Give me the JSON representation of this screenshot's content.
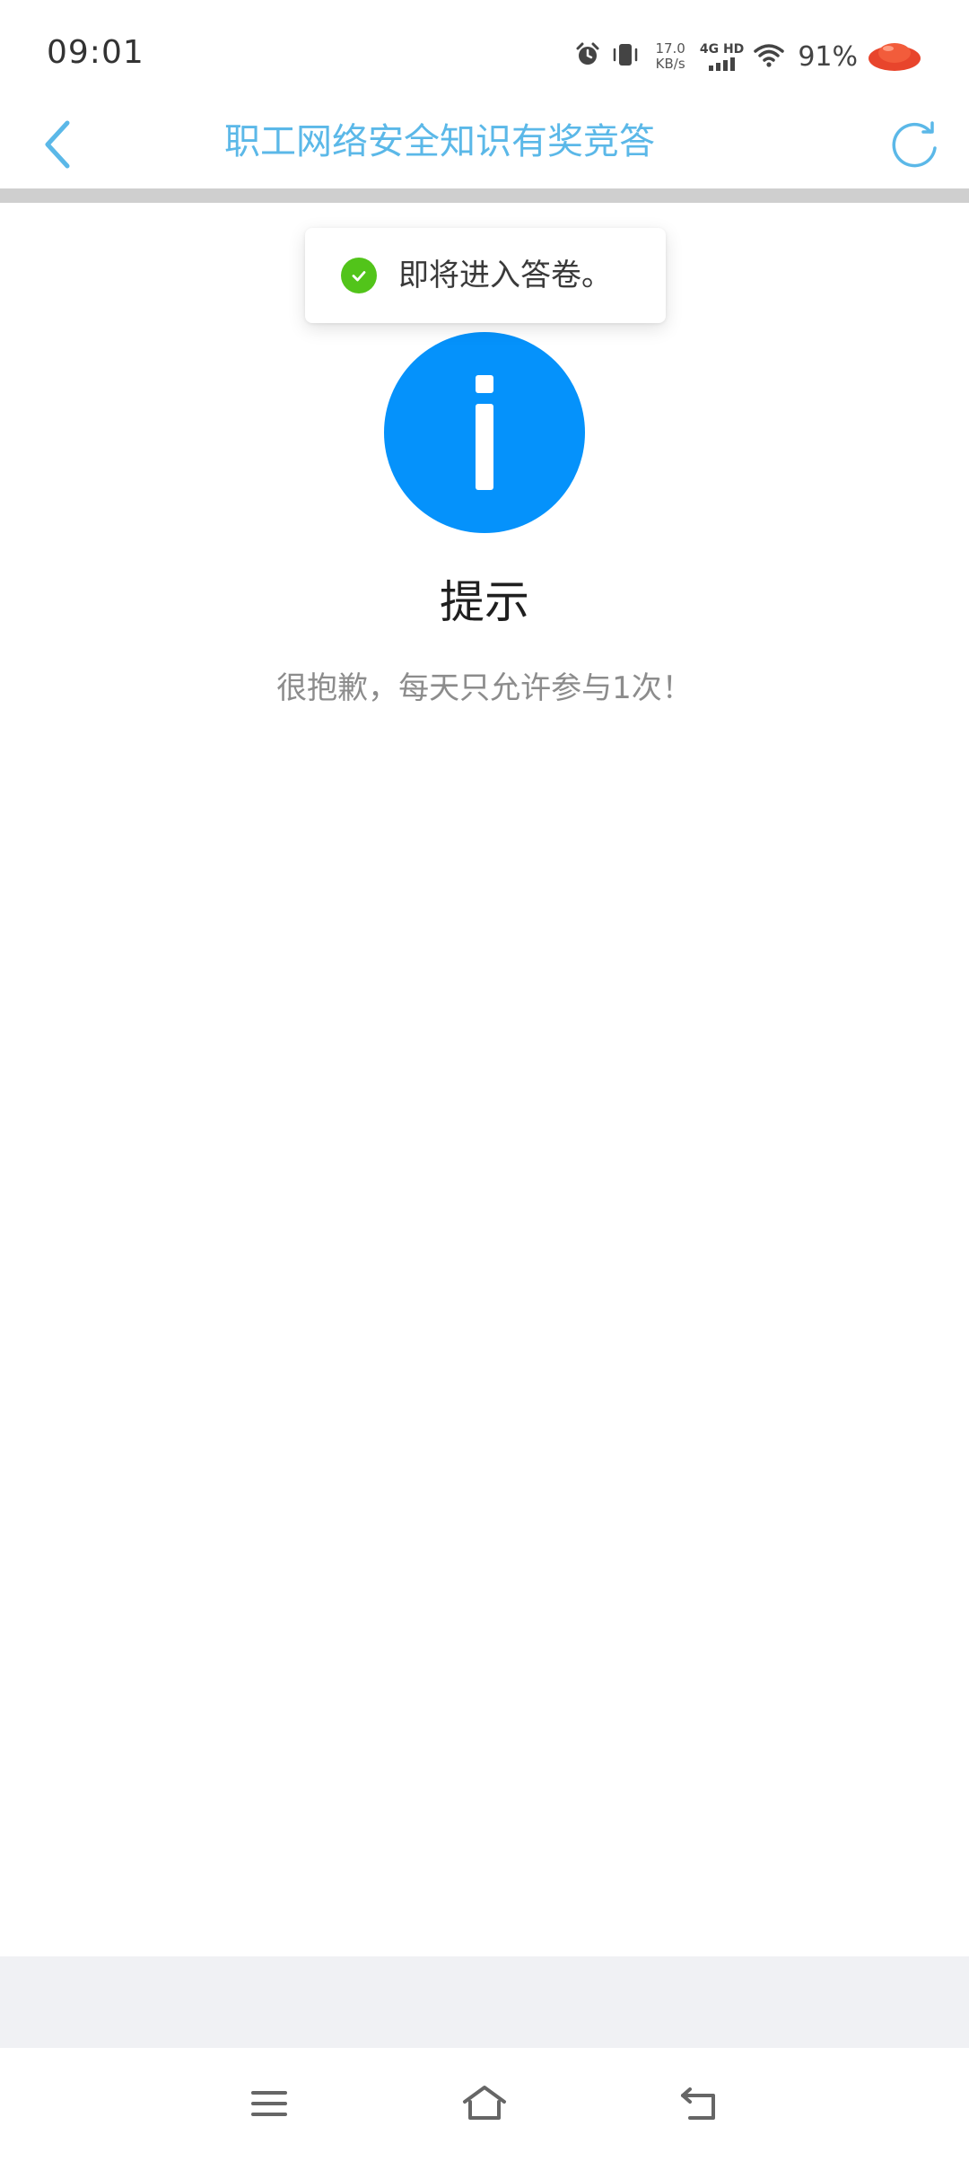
{
  "status_bar": {
    "time": "09:01",
    "net_speed_value": "17.0",
    "net_speed_unit": "KB/s",
    "network_type": "4G HD",
    "battery": "91%",
    "icons": [
      "alarm-icon",
      "vibrate-icon",
      "signal-icon",
      "wifi-icon",
      "app-badge-icon"
    ]
  },
  "header": {
    "title": "职工网络安全知识有奖竞答",
    "back_icon": "chevron-left-icon",
    "refresh_icon": "refresh-icon",
    "accent_color": "#5bb8e8"
  },
  "toast": {
    "message": "即将进入答卷。",
    "icon": "check-circle-icon",
    "icon_color": "#52c41a"
  },
  "dialog": {
    "icon": "info-icon",
    "icon_color": "#0592fb",
    "title": "提示",
    "message": "很抱歉，每天只允许参与1次！"
  },
  "nav_bar": {
    "icons": [
      "menu-icon",
      "home-icon",
      "back-icon"
    ]
  }
}
